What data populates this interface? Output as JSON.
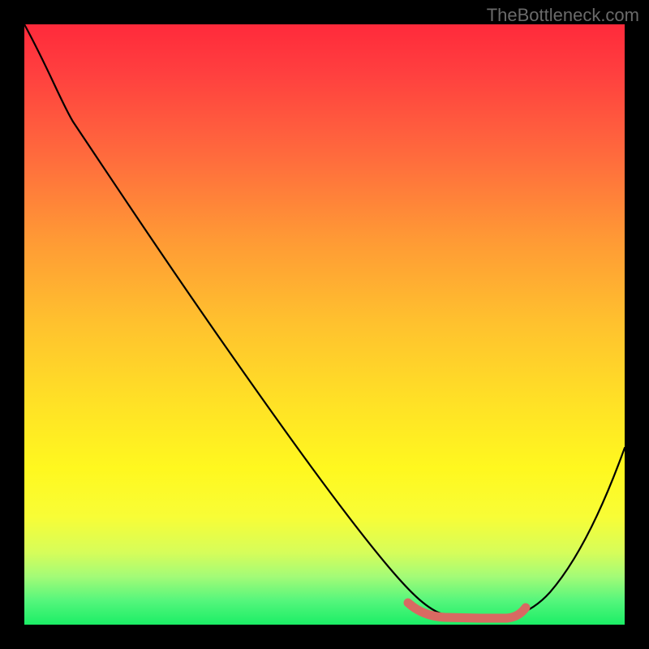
{
  "watermark_text": "TheBottleneck.com",
  "chart_data": {
    "type": "line",
    "title": "",
    "xlabel": "",
    "ylabel": "",
    "xlim": [
      0,
      100
    ],
    "ylim": [
      0,
      100
    ],
    "grid": false,
    "series": [
      {
        "name": "curve",
        "x": [
          0,
          5,
          10,
          15,
          20,
          25,
          30,
          35,
          40,
          45,
          50,
          55,
          60,
          63,
          67,
          71,
          74,
          78,
          82,
          86,
          90,
          95,
          100
        ],
        "values": [
          100,
          96,
          90,
          82,
          74,
          66,
          58,
          50,
          42,
          34,
          26,
          18,
          11,
          7,
          4,
          2,
          1,
          1,
          1,
          3,
          7,
          16,
          30
        ]
      }
    ],
    "highlight": {
      "name": "trough",
      "x": [
        63,
        67,
        71,
        74,
        78,
        82
      ],
      "values": [
        1,
        1,
        1,
        1,
        1,
        1
      ]
    },
    "colors": {
      "gradient_top": "#ff2a3b",
      "gradient_mid": "#ffe126",
      "gradient_bottom": "#1bee66",
      "curve": "#000000",
      "trough": "#d86a62",
      "frame": "#000000"
    }
  }
}
